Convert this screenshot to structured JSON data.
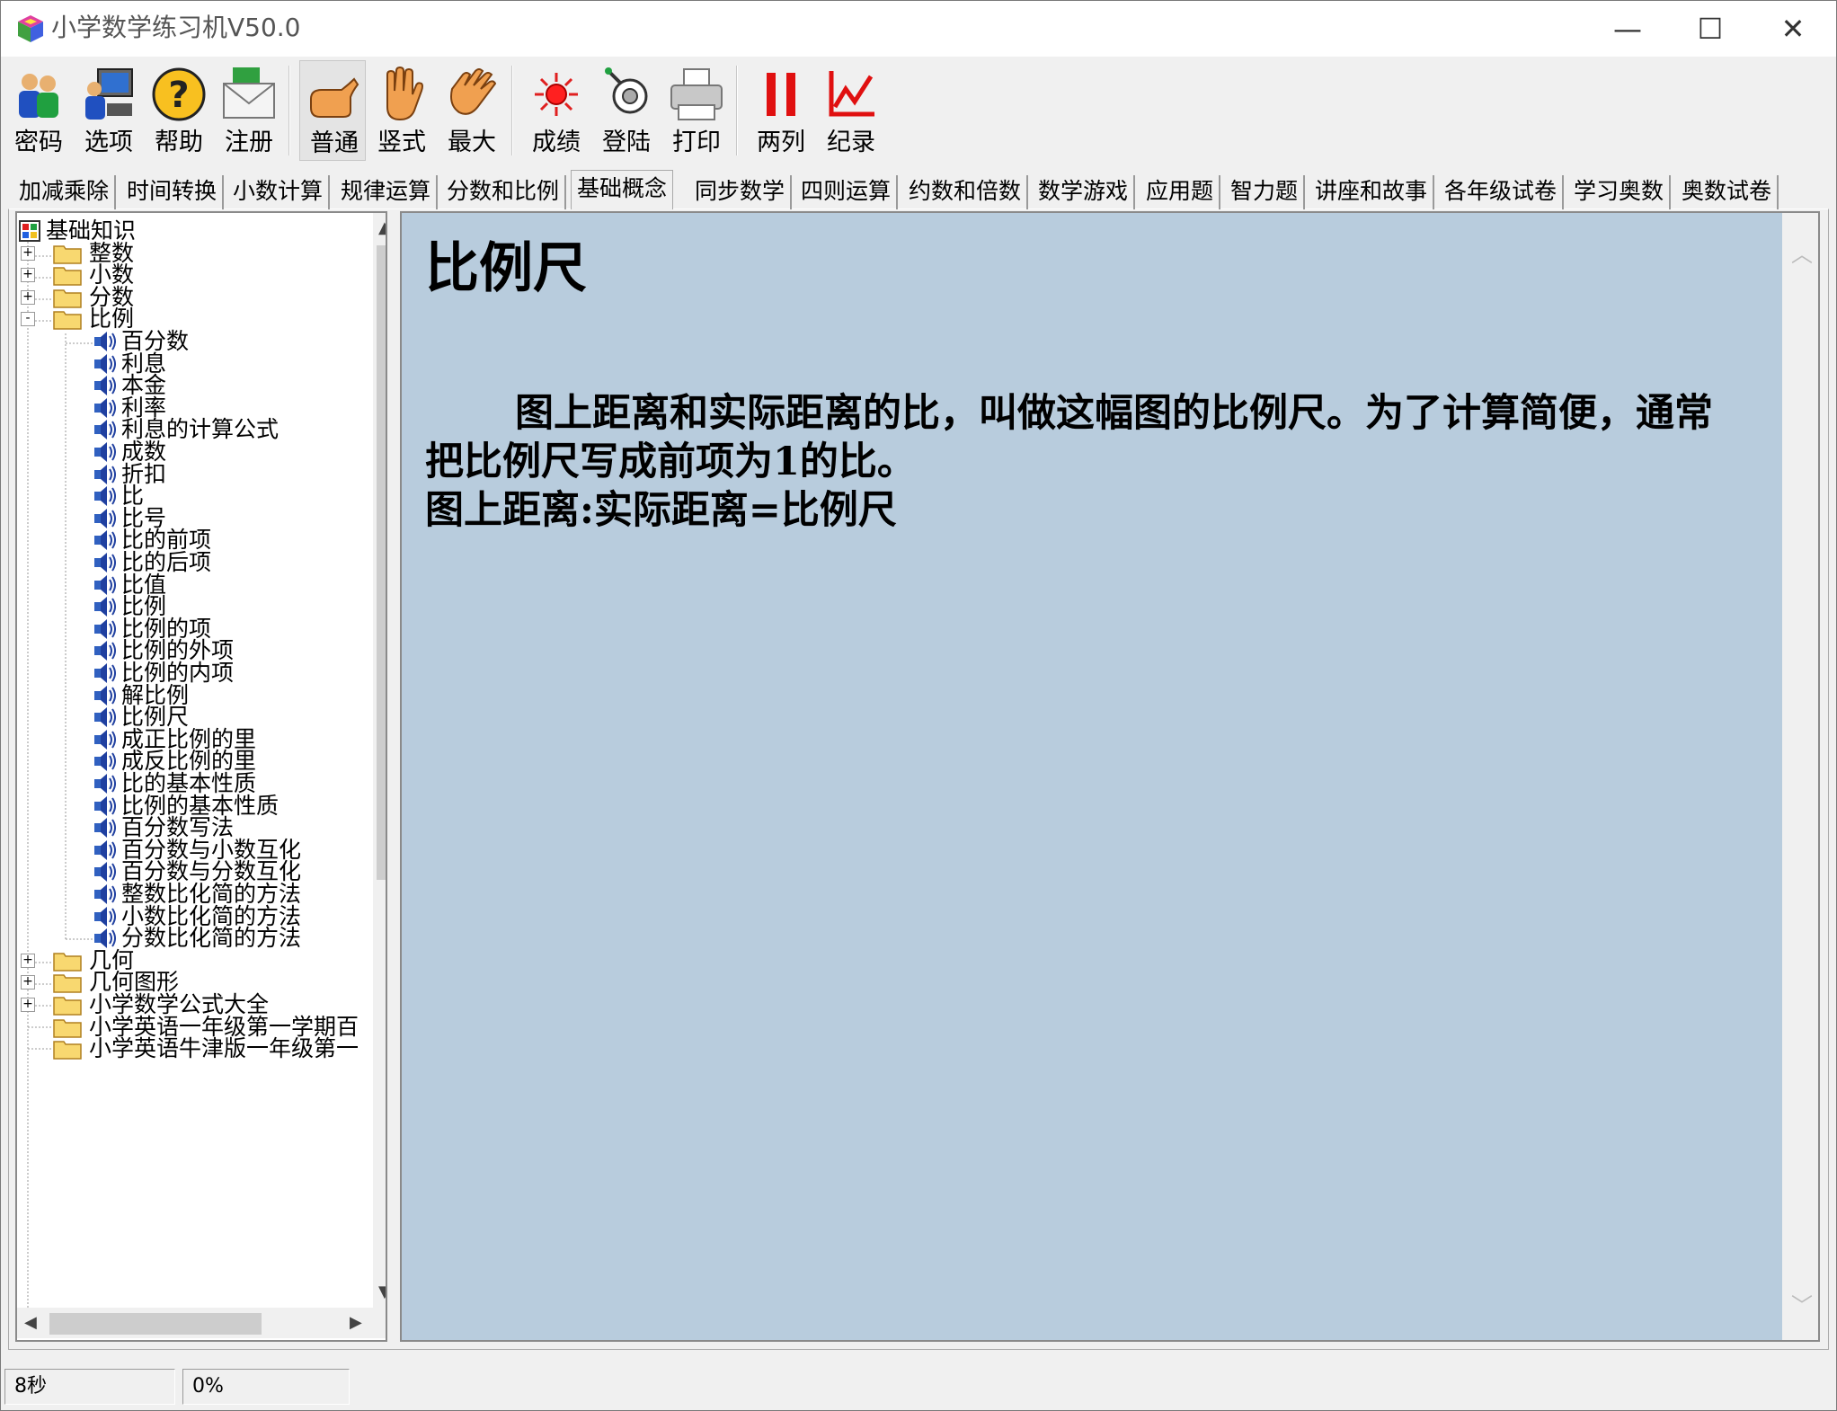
{
  "window": {
    "title": "小学数学练习机V50.0",
    "controls": {
      "minimize": "—",
      "maximize": "☐",
      "close": "✕"
    }
  },
  "toolbar": {
    "buttons": [
      {
        "label": "密码",
        "icon": "people-icon"
      },
      {
        "label": "选项",
        "icon": "computer-icon"
      },
      {
        "label": "帮助",
        "icon": "help-icon"
      },
      {
        "label": "注册",
        "icon": "mail-icon"
      },
      {
        "label": "普通",
        "icon": "hand-point-icon"
      },
      {
        "label": "竖式",
        "icon": "hand-raise-icon"
      },
      {
        "label": "最大",
        "icon": "hand-wave-icon"
      },
      {
        "label": "成绩",
        "icon": "sun-icon"
      },
      {
        "label": "登陆",
        "icon": "key-icon"
      },
      {
        "label": "打印",
        "icon": "printer-icon"
      },
      {
        "label": "两列",
        "icon": "two-columns-icon"
      },
      {
        "label": "纪录",
        "icon": "chart-icon"
      }
    ]
  },
  "tabs": [
    "加减乘除",
    "时间转换",
    "小数计算",
    "规律运算",
    "分数和比例",
    "基础概念",
    "同步数学",
    "四则运算",
    "约数和倍数",
    "数学游戏",
    "应用题",
    "智力题",
    "讲座和故事",
    "各年级试卷",
    "学习奥数",
    "奥数试卷"
  ],
  "active_tab": "基础概念",
  "tree": {
    "root": "基础知识",
    "top_folders_before": [
      "整数",
      "小数",
      "分数"
    ],
    "open_folder": "比例",
    "open_folder_items": [
      "百分数",
      "利息",
      "本金",
      "利率",
      "利息的计算公式",
      "成数",
      "折扣",
      "比",
      "比号",
      "比的前项",
      "比的后项",
      "比值",
      "比例",
      "比例的项",
      "比例的外项",
      "比例的内项",
      "解比例",
      "比例尺",
      "成正比例的里",
      "成反比例的里",
      "比的基本性质",
      "比例的基本性质",
      "百分数写法",
      "百分数与小数互化",
      "百分数与分数互化",
      "整数比化简的方法",
      "小数比化简的方法",
      "分数比化简的方法"
    ],
    "top_folders_after": [
      {
        "label": "几何",
        "expandable": true
      },
      {
        "label": "几何图形",
        "expandable": true
      },
      {
        "label": "小学数学公式大全",
        "expandable": true
      },
      {
        "label": "小学英语一年级第一学期百",
        "expandable": false
      },
      {
        "label": "小学英语牛津版一年级第一",
        "expandable": false
      }
    ]
  },
  "content": {
    "heading": "比例尺",
    "paragraph": "图上距离和实际距离的比，叫做这幅图的比例尺。为了计算简便，通常把比例尺写成前项为1的比。",
    "formula": "图上距离:实际距离=比例尺"
  },
  "status": {
    "time": "8秒",
    "progress": "0%"
  }
}
